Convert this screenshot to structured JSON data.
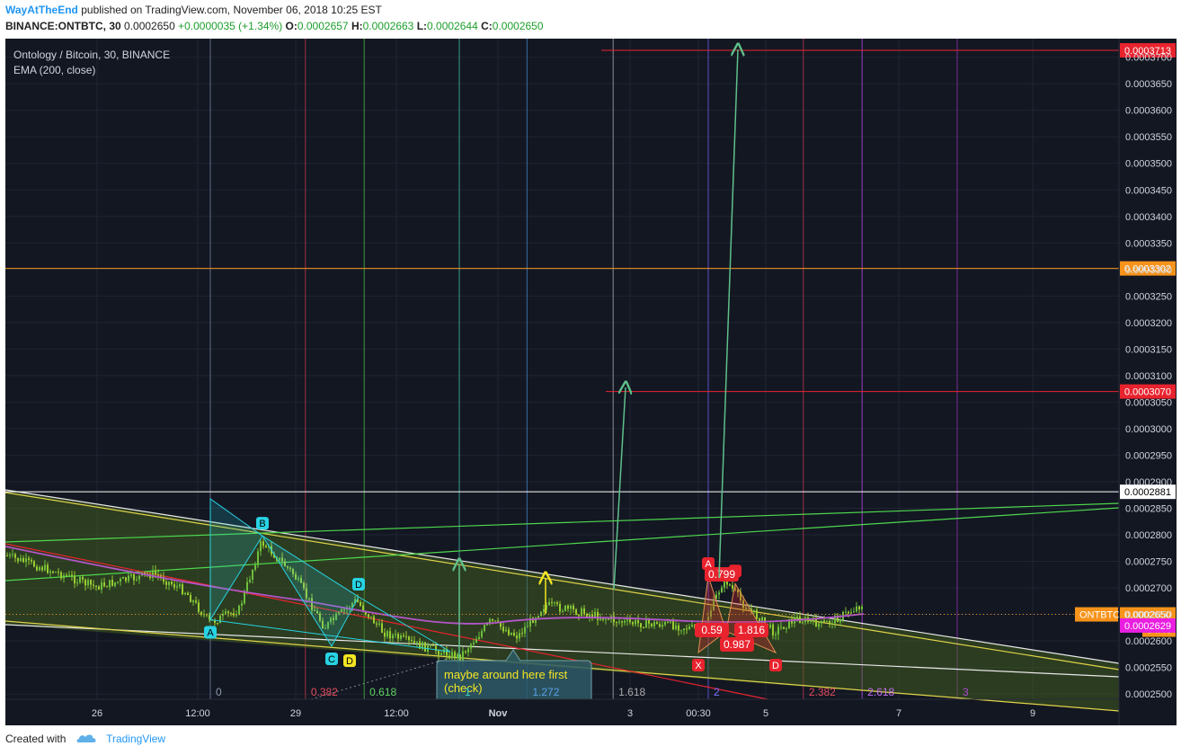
{
  "header": {
    "author": "WayAtTheEnd",
    "published": "published on TradingView.com, November 06, 2018 10:25 EST",
    "symbol": "BINANCE:ONTBTC, 30",
    "price": "0.0002650",
    "change": "+0.0000035 (+1.34%)",
    "o_label": "O:",
    "o_value": "0.0002657",
    "h_label": "H:",
    "h_value": "0.0002663",
    "l_label": "L:",
    "l_value": "0.0002644",
    "c_label": "C:",
    "c_value": "0.0002650"
  },
  "footer": {
    "created_with": "Created with",
    "brand": "TradingView"
  },
  "colors": {
    "background": "#131722",
    "grid": "#1f2433",
    "candle_up": "#6fbf3c",
    "candle_down": "#9acd32",
    "ema": "#b355c8",
    "red_level": "#e8232e",
    "orange_level": "#f7931a",
    "white_level": "#ffffff",
    "cyan_pattern": "#27d3e3",
    "red_pattern": "#e8232e",
    "arrow_green": "#5fc08a",
    "arrow_yellow": "#f5e623"
  },
  "chart_data": {
    "type": "candlestick",
    "title": "Ontology / Bitcoin, 30, BINANCE",
    "indicator": "EMA (200, close)",
    "xticks": [
      "26",
      "12:00",
      "29",
      "12:00",
      "Nov",
      "3",
      "00:30",
      "5",
      "7",
      "9"
    ],
    "yticks": [
      "0.0002500",
      "0.0002550",
      "0.0002600",
      "0.0002650",
      "0.0002700",
      "0.0002750",
      "0.0002800",
      "0.0002850",
      "0.0002900",
      "0.0002950",
      "0.0003000",
      "0.0003050",
      "0.0003100",
      "0.0003150",
      "0.0003200",
      "0.0003250",
      "0.0003300",
      "0.0003350",
      "0.0003400",
      "0.0003450",
      "0.0003500",
      "0.0003550",
      "0.0003600",
      "0.0003650",
      "0.0003700"
    ],
    "ylim": [
      0.000249,
      0.0003735
    ],
    "price_levels": [
      {
        "value": 0.0003713,
        "label": "0.0003713",
        "color": "red"
      },
      {
        "value": 0.0003302,
        "label": "0.0003302",
        "color": "orange"
      },
      {
        "value": 0.000307,
        "label": "0.0003070",
        "color": "red"
      },
      {
        "value": 0.0002881,
        "label": "0.0002881",
        "color": "white"
      }
    ],
    "last_price": {
      "symbol": "ONTBTC",
      "value": "0.0002650",
      "countdown": "04:40"
    },
    "ema_value": "0.0002629",
    "fib_time_labels": [
      {
        "label": "0",
        "t": 0.0
      },
      {
        "label": "0.382",
        "t": 0.382
      },
      {
        "label": "0.618",
        "t": 0.618
      },
      {
        "label": "1",
        "t": 1.0
      },
      {
        "label": "1.272",
        "t": 1.272
      },
      {
        "label": "1.618",
        "t": 1.618
      },
      {
        "label": "2",
        "t": 2.0
      },
      {
        "label": "2.382",
        "t": 2.382
      },
      {
        "label": "2.618",
        "t": 2.618
      },
      {
        "label": "3",
        "t": 3.0
      }
    ],
    "cyan_pattern_points": [
      {
        "label": "A",
        "price": 0.000264
      },
      {
        "label": "B",
        "price": 0.0002798
      },
      {
        "label": "C",
        "price": 0.000259
      },
      {
        "label": "D",
        "price": 0.0002683
      }
    ],
    "yellow_point": {
      "label": "D",
      "price": 0.000259
    },
    "red_pattern_points": [
      {
        "label": "X",
        "price": 0.0002578
      },
      {
        "label": "A",
        "price": 0.0002722
      },
      {
        "label": "B",
        "price": 0.0002618
      },
      {
        "label": "C",
        "price": 0.0002708
      },
      {
        "label": "D",
        "price": 0.0002578
      }
    ],
    "red_ratios": [
      "0.799",
      "0.59",
      "1.816",
      "0.987"
    ],
    "callout": "maybe around here first (check)"
  }
}
